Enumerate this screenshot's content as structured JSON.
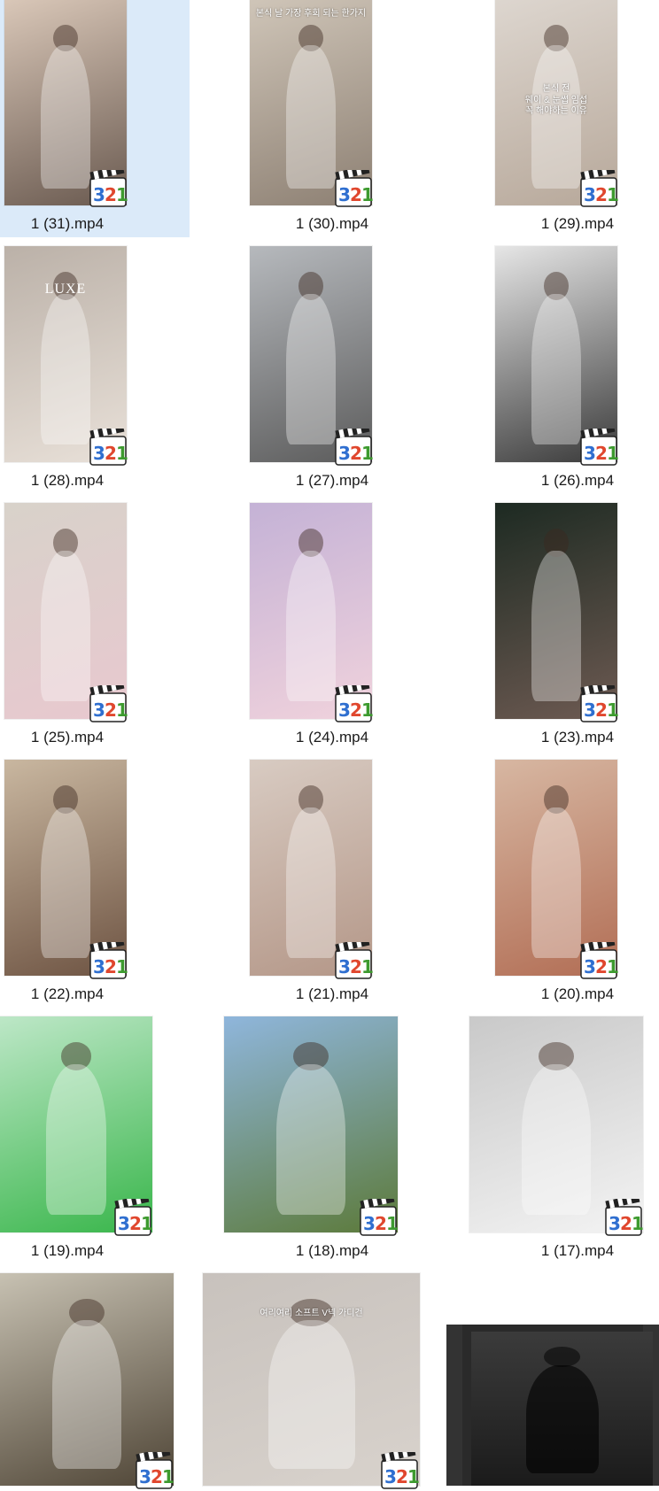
{
  "files": [
    {
      "name": "1 (31).mp4",
      "selected": true,
      "bg": [
        "#d9c7b8",
        "#6a5a50"
      ]
    },
    {
      "name": "1 (30).mp4",
      "selected": false,
      "bg": [
        "#cfc5b8",
        "#8d8073"
      ],
      "overlay": "본식 날 가장 후회 되는 한가지"
    },
    {
      "name": "1 (29).mp4",
      "selected": false,
      "bg": [
        "#ddd6cf",
        "#b7a89a"
      ],
      "overlay": "본식 전\n웨이 & 눈썹 임섭\n꼭 해야하는 이유"
    },
    {
      "name": "1 (28).mp4",
      "selected": false,
      "bg": [
        "#bbb1a8",
        "#e8e0d8"
      ],
      "overlay": "LUXE"
    },
    {
      "name": "1 (27).mp4",
      "selected": false,
      "bg": [
        "#b6b9bd",
        "#5c5c5c"
      ]
    },
    {
      "name": "1 (26).mp4",
      "selected": false,
      "bg": [
        "#e6e6e6",
        "#3a3a3a"
      ]
    },
    {
      "name": "1 (25).mp4",
      "selected": false,
      "bg": [
        "#d8d2ca",
        "#e8c8cf"
      ]
    },
    {
      "name": "1 (24).mp4",
      "selected": false,
      "bg": [
        "#c4b2d6",
        "#f0d2dc"
      ]
    },
    {
      "name": "1 (23).mp4",
      "selected": false,
      "bg": [
        "#1d2a22",
        "#6d5a52"
      ]
    },
    {
      "name": "1 (22).mp4",
      "selected": false,
      "bg": [
        "#c9b7a0",
        "#6e5443"
      ]
    },
    {
      "name": "1 (21).mp4",
      "selected": false,
      "bg": [
        "#d8cbc2",
        "#b49788"
      ]
    },
    {
      "name": "1 (20).mp4",
      "selected": false,
      "bg": [
        "#d7b7a2",
        "#b26e55"
      ]
    },
    {
      "name": "1 (19).mp4",
      "selected": false,
      "bg": [
        "#bde7c7",
        "#39b64b"
      ]
    },
    {
      "name": "1 (18).mp4",
      "selected": false,
      "bg": [
        "#8fb6dc",
        "#5c7a3a"
      ]
    },
    {
      "name": "1 (17).mp4",
      "selected": false,
      "bg": [
        "#c9c9c9",
        "#f3f3f3"
      ]
    },
    {
      "name": "",
      "selected": false,
      "bg": [
        "#c7c1b2",
        "#4f4536"
      ]
    },
    {
      "name": "",
      "selected": false,
      "bg": [
        "#c8c2bd",
        "#d8d2cc"
      ],
      "overlay": "여리여리 소프트 V넥 가디건"
    }
  ],
  "player_badge": {
    "text": "321"
  },
  "colors": {
    "selection": "#dbeaf9",
    "badge_blue": "#2f6fd0",
    "badge_red": "#e0472e",
    "badge_green": "#3d9a2e"
  }
}
